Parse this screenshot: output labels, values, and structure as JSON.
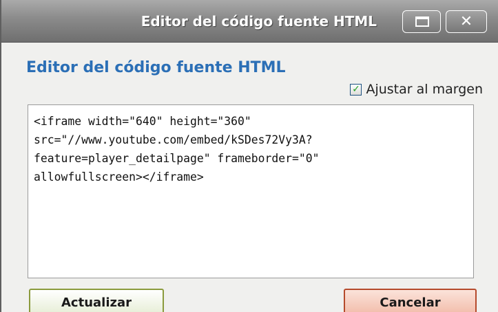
{
  "window": {
    "title": "Editor del código fuente HTML",
    "maximize_icon": "maximize-icon",
    "close_icon": "close-icon",
    "close_glyph": "✕"
  },
  "dialog": {
    "heading": "Editor del código fuente HTML",
    "wrap_label": "Ajustar al margen",
    "wrap_checked": true,
    "check_glyph": "✓"
  },
  "editor": {
    "lines": [
      "<iframe width=\"640\" height=\"360\"",
      "src=\"//www.youtube.com/embed/kSDes72Vy3A?",
      "feature=player_detailpage\" frameborder=\"0\"",
      "allowfullscreen></iframe>"
    ]
  },
  "buttons": {
    "update": "Actualizar",
    "cancel": "Cancelar"
  },
  "colors": {
    "heading": "#2b6fb6",
    "titlebar": "#8a8a8a"
  }
}
